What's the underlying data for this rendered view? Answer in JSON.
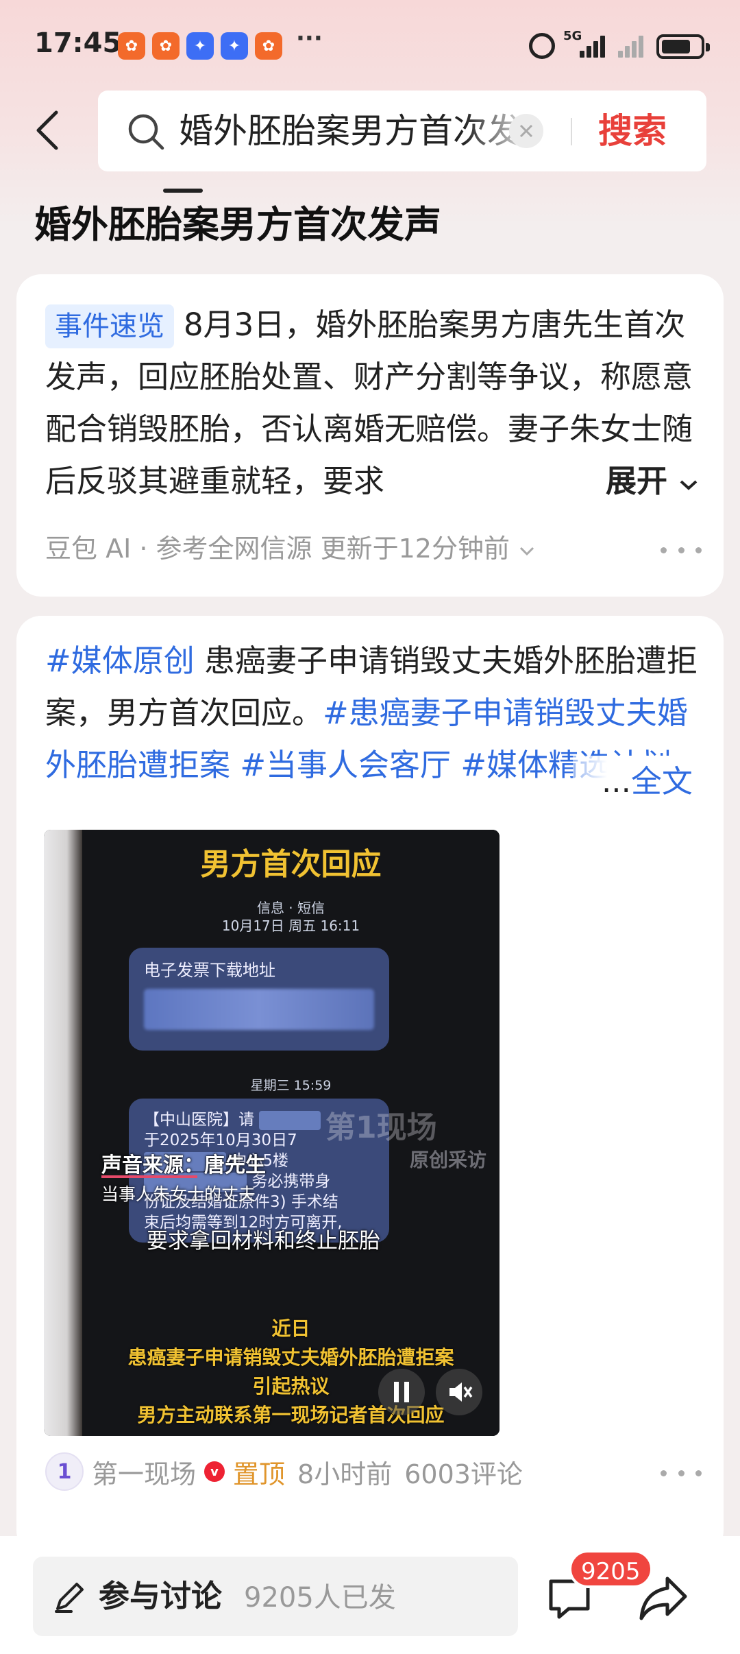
{
  "status_bar": {
    "time": "17:45",
    "notifications": [
      {
        "icon": "app-orange-icon",
        "color": "#f36a2b"
      },
      {
        "icon": "app-orange-icon",
        "color": "#f36a2b"
      },
      {
        "icon": "app-blue-icon",
        "color": "#3d6ef5"
      },
      {
        "icon": "app-blue-icon",
        "color": "#3d6ef5"
      },
      {
        "icon": "app-orange-icon",
        "color": "#f36a2b"
      }
    ],
    "more": "···",
    "network": "5G",
    "battery_level": 0.75
  },
  "search": {
    "query": "婚外胚胎案男方首次发声",
    "button": "搜索"
  },
  "page_title": "婚外胚胎案男方首次发声",
  "summary_card": {
    "tag": "事件速览",
    "text": "8月3日，婚外胚胎案男方唐先生首次发声，回应胚胎处置、财产分割等争议，称愿意配合销毁胚胎，否认离婚无赔偿。妻子朱女士随后反驳其避重就轻，要求",
    "expand": "展开",
    "source": "豆包 AI · 参考全网信源 更新于12分钟前"
  },
  "post": {
    "hashtag1": "#媒体原创",
    "text1": " 患癌妻子申请销毁丈夫婚外胚胎遭拒案，男方首次回应。",
    "hashtag2": "#患癌妻子申请销毁丈夫婚外胚胎遭拒案",
    "hashtag3": " #当事人会客",
    "hashtag4": "厅 #媒体精选计划",
    "more_prefix": "...",
    "full_text": "全文",
    "video": {
      "title": "男方首次回应",
      "sms_header": "信息 · 短信",
      "sms_date": "10月17日 周五 16:11",
      "bubble1": "电子发票下载地址",
      "bubble2_time": "星期三 15:59",
      "bubble2_head": "【中山医院】请",
      "bubble2_lines": [
        "于2025年10月30日7",
        "中心5楼",
        "务必携带身",
        "份证及结婚证原件3) 手术结",
        "束后均需等到12时方可离开,"
      ],
      "watermark": "第1现场",
      "watermark_sub": "原创采访",
      "subtitle_source": "声音来源：唐先生",
      "subtitle_role": "当事人朱女士的丈夫",
      "subtitle_speech": "要求拿回材料和终止胚胎",
      "caption_lines": [
        "近日",
        "患癌妻子申请销毁丈夫婚外胚胎遭拒案",
        "引起热议",
        "男方主动联系第一现场记者首次回应"
      ]
    },
    "author": "第一现场",
    "pinned": "置顶",
    "time": "8小时前",
    "comments": "6003评论"
  },
  "bottom_bar": {
    "discuss_label": "参与讨论",
    "discuss_count": "9205人已发",
    "comment_badge": "9205"
  }
}
